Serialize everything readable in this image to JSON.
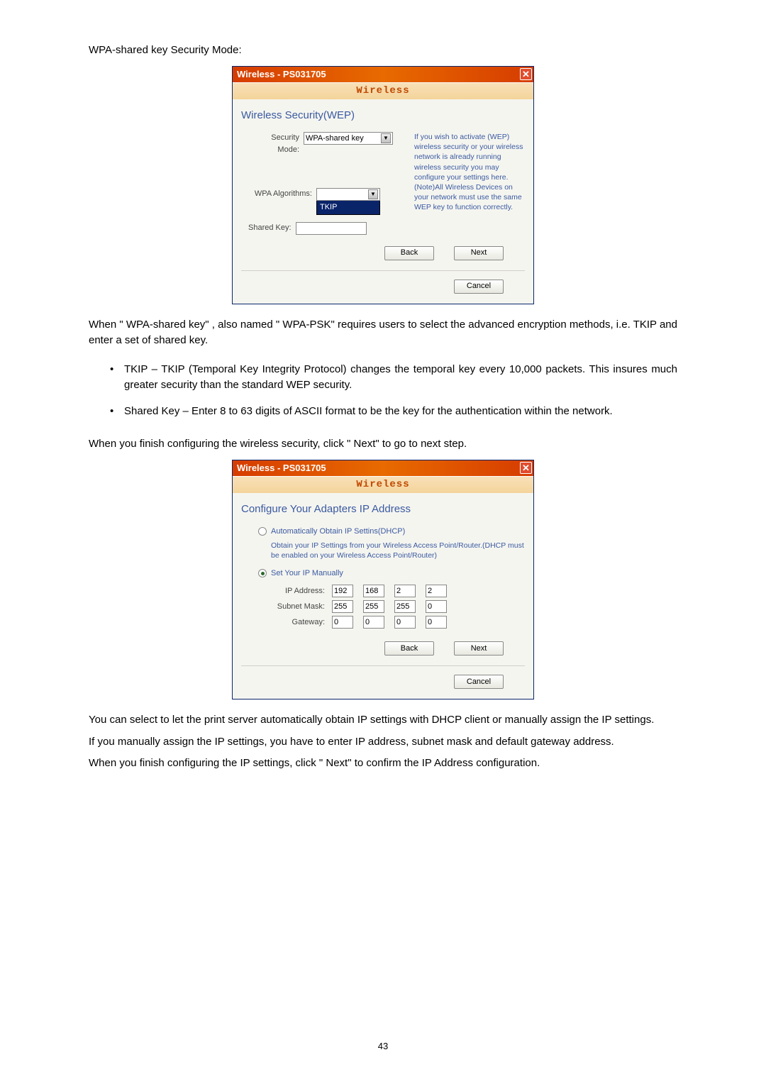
{
  "heading_wpa": "WPA-shared key Security Mode:",
  "dialog1": {
    "title": "Wireless - PS031705",
    "banner": "Wireless",
    "section_title": "Wireless Security(WEP)",
    "security_mode_label": "Security Mode:",
    "security_mode_value": "WPA-shared key",
    "wpa_algorithms_label": "WPA Algorithms:",
    "wpa_algorithms_value": "",
    "wpa_dropdown_option": "TKIP",
    "shared_key_label": "Shared Key:",
    "help_text": "If you wish to activate (WEP) wireless security or your wireless network is already running wireless security you may configure your settings here. (Note)All Wireless Devices on your network must use the same WEP key to function correctly.",
    "back": "Back",
    "next": "Next",
    "cancel": "Cancel"
  },
  "para1": "When \" WPA-shared key\" , also named \" WPA-PSK\" requires users to select the advanced encryption methods, i.e. TKIP and enter a set of shared key.",
  "bullets": {
    "tkip": "TKIP – TKIP (Temporal Key Integrity Protocol) changes the temporal key every 10,000 packets. This insures much greater security than the standard WEP security.",
    "shared_key": "Shared Key – Enter 8 to 63 digits of ASCII format to be the key for the authentication within the network."
  },
  "para2": "When you finish configuring the wireless security, click \" Next\" to go to next step.",
  "dialog2": {
    "title": "Wireless - PS031705",
    "banner": "Wireless",
    "section_title": "Configure Your Adapters IP Address",
    "radio_dhcp": "Automatically Obtain IP Settins(DHCP)",
    "dhcp_note": "Obtain your IP Settings from your Wireless Access Point/Router.(DHCP must be enabled on your Wireless Access Point/Router)",
    "radio_manual": "Set Your IP Manually",
    "ip_address_label": "IP Address:",
    "subnet_mask_label": "Subnet Mask:",
    "gateway_label": "Gateway:",
    "ip": [
      "192",
      "168",
      "2",
      "2"
    ],
    "mask": [
      "255",
      "255",
      "255",
      "0"
    ],
    "gateway": [
      "0",
      "0",
      "0",
      "0"
    ],
    "back": "Back",
    "next": "Next",
    "cancel": "Cancel"
  },
  "para3": "You can select to let the print server automatically obtain IP settings with DHCP client or manually assign the IP settings.",
  "para4": "If you manually assign the IP settings, you have to enter IP address, subnet mask and default gateway address.",
  "para5": "When you finish configuring the IP settings, click \" Next\" to confirm the IP Address configuration.",
  "page_number": "43"
}
